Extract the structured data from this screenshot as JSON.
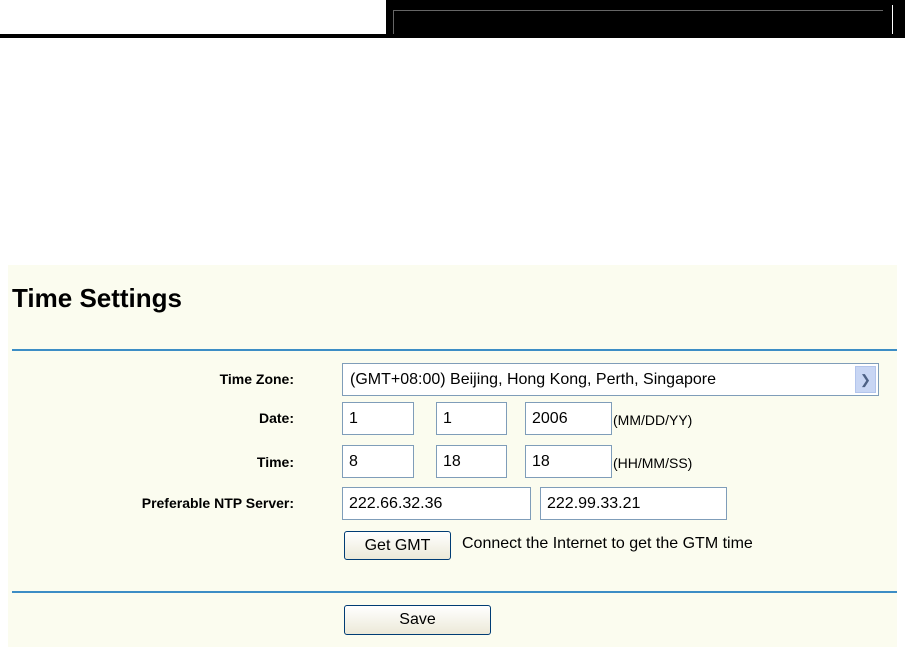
{
  "title": "Time Settings",
  "labels": {
    "time_zone": "Time Zone:",
    "date": "Date:",
    "time": "Time:",
    "ntp": "Preferable NTP Server:"
  },
  "time_zone": "(GMT+08:00) Beijing, Hong Kong, Perth, Singapore",
  "date": {
    "month": "1",
    "day": "1",
    "year": "2006",
    "format": "(MM/DD/YY)"
  },
  "time": {
    "hour": "8",
    "minute": "18",
    "second": "18",
    "format": "(HH/MM/SS)"
  },
  "ntp": {
    "primary": "222.66.32.36",
    "secondary": "222.99.33.21"
  },
  "get_gmt": {
    "label": "Get GMT",
    "hint": "Connect the Internet to get the GTM time"
  },
  "save_label": "Save"
}
